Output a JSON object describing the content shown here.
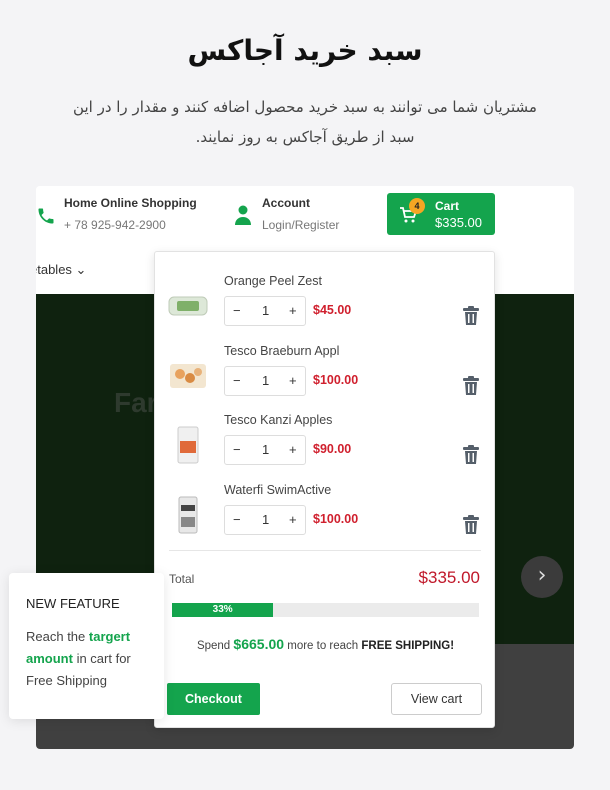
{
  "hero": {
    "title": "سبد خرید آجاکس",
    "subtitle": "مشتریان شما می توانند به سبد خرید محصول اضافه کنند و مقدار را در این سبد از طریق آجاکس به روز نمایند."
  },
  "header": {
    "phone_title": "Home Online Shopping",
    "phone_number": "+ 78 925-942-2900",
    "account_title": "Account",
    "account_link": "Login/Register",
    "cart_label": "Cart",
    "cart_total": "$335.00",
    "cart_count": "4",
    "category_partial": "etables"
  },
  "banner": {
    "partial_text": "Far"
  },
  "cart": {
    "items": [
      {
        "name": "Orange Peel Zest",
        "qty": "1",
        "price": "$45.00"
      },
      {
        "name": "Tesco Braeburn Appl",
        "qty": "1",
        "price": "$100.00"
      },
      {
        "name": "Tesco Kanzi Apples",
        "qty": "1",
        "price": "$90.00"
      },
      {
        "name": "Waterfi SwimActive",
        "qty": "1",
        "price": "$100.00"
      }
    ],
    "total_label": "Total",
    "total_value": "$335.00",
    "progress_label": "33%",
    "progress_fraction": 0.33,
    "spend_prefix": "Spend",
    "spend_amount": "$665.00",
    "spend_middle": "more to reach",
    "spend_suffix": "FREE SHIPPING!",
    "checkout_label": "Checkout",
    "viewcart_label": "View cart"
  },
  "feature": {
    "heading": "NEW FEATURE",
    "line1": "Reach the",
    "highlight": "targert amount",
    "line2": "in cart for Free Shipping"
  },
  "colors": {
    "accent": "#14a44d",
    "price": "#d0202e",
    "badge": "#f5a623"
  }
}
